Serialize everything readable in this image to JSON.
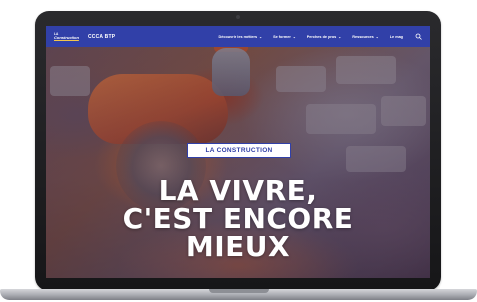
{
  "header": {
    "logo_small": "LA",
    "logo_big": "Construction",
    "partner_logo": "CCCA BTP",
    "nav": [
      {
        "label": "Découvrir les métiers",
        "has_dropdown": true
      },
      {
        "label": "Se former",
        "has_dropdown": true
      },
      {
        "label": "Perches de pros",
        "has_dropdown": true
      },
      {
        "label": "Ressources",
        "has_dropdown": true
      },
      {
        "label": "Le mag",
        "has_dropdown": false
      }
    ],
    "search_icon": "search-icon"
  },
  "hero": {
    "badge": "LA CONSTRUCTION",
    "headline_lines": [
      "LA VIVRE,",
      "C'EST ENCORE",
      "MIEUX"
    ]
  },
  "colors": {
    "brand_blue": "#3140a8",
    "accent_yellow": "#f2c54c",
    "laptop_frame": "#1e1e20",
    "headline_text": "#ffffff"
  }
}
